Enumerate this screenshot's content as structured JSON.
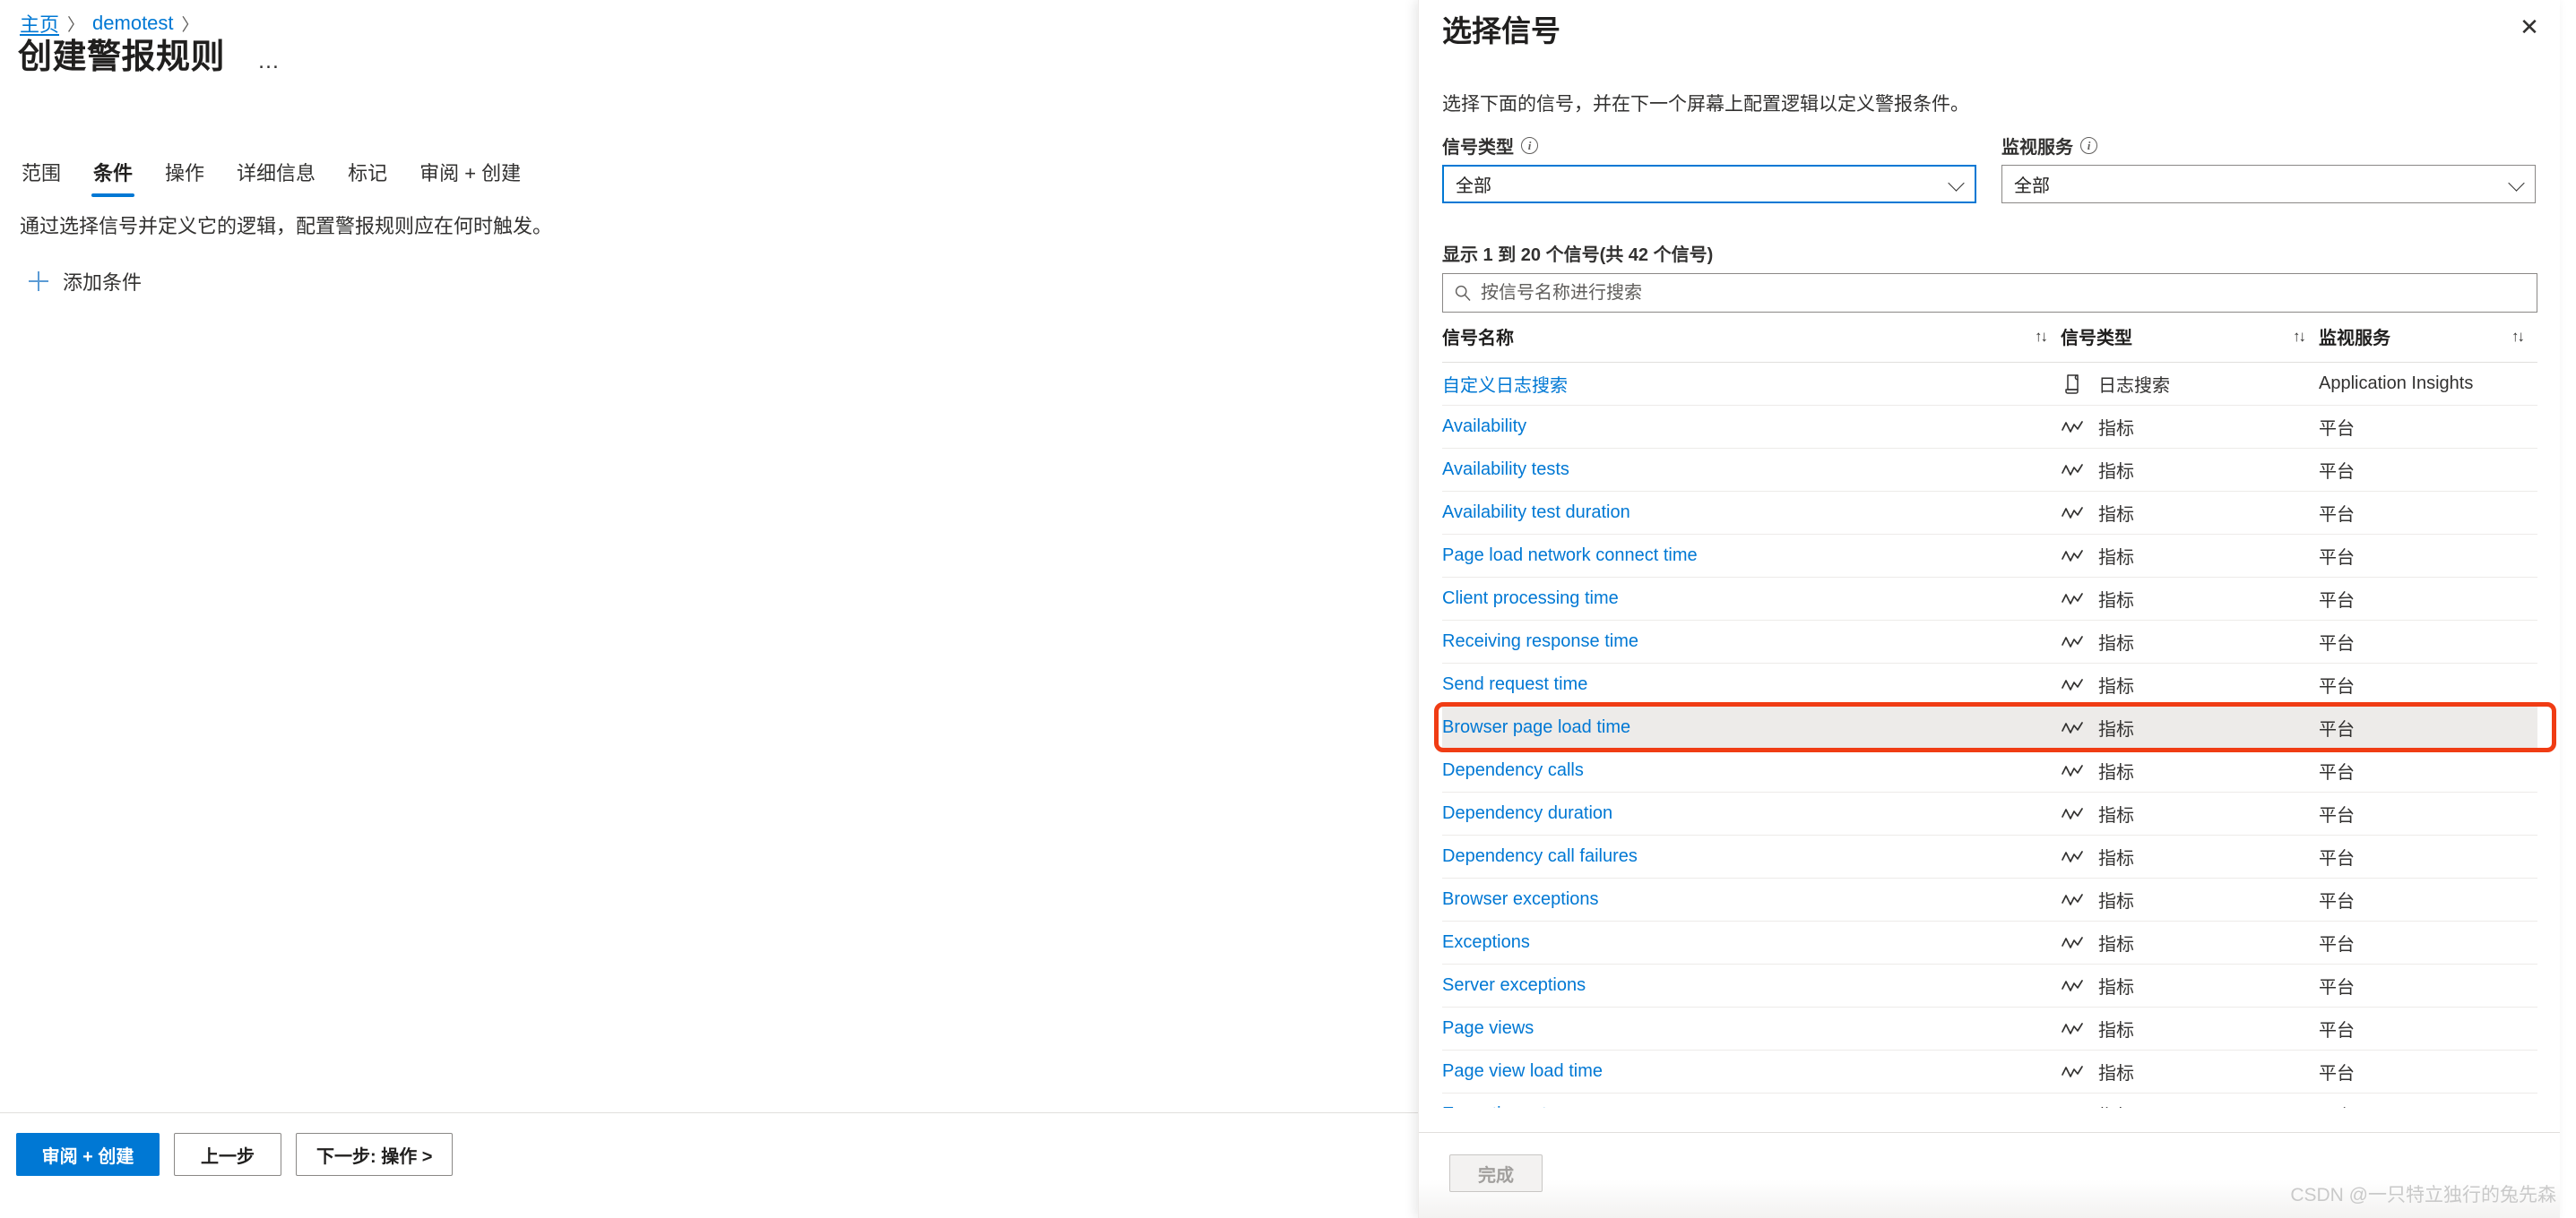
{
  "breadcrumb": {
    "home": "主页",
    "resource": "demotest",
    "separator": "〉"
  },
  "page": {
    "title": "创建警报规则",
    "more_label": "…"
  },
  "tabs": [
    {
      "label": "范围",
      "active": false
    },
    {
      "label": "条件",
      "active": true
    },
    {
      "label": "操作",
      "active": false
    },
    {
      "label": "详细信息",
      "active": false
    },
    {
      "label": "标记",
      "active": false
    },
    {
      "label": "审阅 + 创建",
      "active": false
    }
  ],
  "condition_tab": {
    "description": "通过选择信号并定义它的逻辑，配置警报规则应在何时触发。",
    "add_condition_label": "添加条件",
    "add_condition_icon": "plus-icon"
  },
  "wizard_footer": {
    "review_create": "审阅 + 创建",
    "previous": "上一步",
    "next": "下一步: 操作 >"
  },
  "panel": {
    "title": "选择信号",
    "close_icon": "✕",
    "subtitle": "选择下面的信号，并在下一个屏幕上配置逻辑以定义警报条件。",
    "filters": [
      {
        "label": "信号类型",
        "value": "全部",
        "focused": true,
        "info_icon": "i"
      },
      {
        "label": "监视服务",
        "value": "全部",
        "focused": false,
        "info_icon": "i"
      }
    ],
    "result_count": "显示 1 到 20 个信号(共 42 个信号)",
    "search": {
      "placeholder": "按信号名称进行搜索",
      "value": "",
      "icon": "search-icon"
    },
    "table": {
      "columns": [
        {
          "label": "信号名称",
          "sort_icon": "↑↓"
        },
        {
          "label": "信号类型",
          "sort_icon": "↑↓"
        },
        {
          "label": "监视服务",
          "sort_icon": "↑↓"
        }
      ],
      "rows": [
        {
          "name": "自定义日志搜索",
          "type": "日志搜索",
          "type_icon": "log-search-icon",
          "service": "Application Insights",
          "highlighted": false
        },
        {
          "name": "Availability",
          "type": "指标",
          "type_icon": "metric-icon",
          "service": "平台",
          "highlighted": false
        },
        {
          "name": "Availability tests",
          "type": "指标",
          "type_icon": "metric-icon",
          "service": "平台",
          "highlighted": false
        },
        {
          "name": "Availability test duration",
          "type": "指标",
          "type_icon": "metric-icon",
          "service": "平台",
          "highlighted": false
        },
        {
          "name": "Page load network connect time",
          "type": "指标",
          "type_icon": "metric-icon",
          "service": "平台",
          "highlighted": false
        },
        {
          "name": "Client processing time",
          "type": "指标",
          "type_icon": "metric-icon",
          "service": "平台",
          "highlighted": false
        },
        {
          "name": "Receiving response time",
          "type": "指标",
          "type_icon": "metric-icon",
          "service": "平台",
          "highlighted": false
        },
        {
          "name": "Send request time",
          "type": "指标",
          "type_icon": "metric-icon",
          "service": "平台",
          "highlighted": false
        },
        {
          "name": "Browser page load time",
          "type": "指标",
          "type_icon": "metric-icon",
          "service": "平台",
          "highlighted": true
        },
        {
          "name": "Dependency calls",
          "type": "指标",
          "type_icon": "metric-icon",
          "service": "平台",
          "highlighted": false
        },
        {
          "name": "Dependency duration",
          "type": "指标",
          "type_icon": "metric-icon",
          "service": "平台",
          "highlighted": false
        },
        {
          "name": "Dependency call failures",
          "type": "指标",
          "type_icon": "metric-icon",
          "service": "平台",
          "highlighted": false
        },
        {
          "name": "Browser exceptions",
          "type": "指标",
          "type_icon": "metric-icon",
          "service": "平台",
          "highlighted": false
        },
        {
          "name": "Exceptions",
          "type": "指标",
          "type_icon": "metric-icon",
          "service": "平台",
          "highlighted": false
        },
        {
          "name": "Server exceptions",
          "type": "指标",
          "type_icon": "metric-icon",
          "service": "平台",
          "highlighted": false
        },
        {
          "name": "Page views",
          "type": "指标",
          "type_icon": "metric-icon",
          "service": "平台",
          "highlighted": false
        },
        {
          "name": "Page view load time",
          "type": "指标",
          "type_icon": "metric-icon",
          "service": "平台",
          "highlighted": false
        },
        {
          "name": "Exception rate",
          "type": "指标",
          "type_icon": "metric-icon",
          "service": "平台",
          "highlighted": false
        }
      ]
    },
    "footer": {
      "done_label": "完成",
      "done_disabled": true
    }
  },
  "annotation": {
    "color": "#f03c14",
    "target_row": "Browser page load time"
  },
  "watermark": "CSDN @一只特立独行的兔先森",
  "colors": {
    "accent": "#0078d4",
    "link": "#0078d4",
    "text": "#201f1e",
    "annotation": "#f03c14",
    "row_highlight": "#edebe9"
  }
}
